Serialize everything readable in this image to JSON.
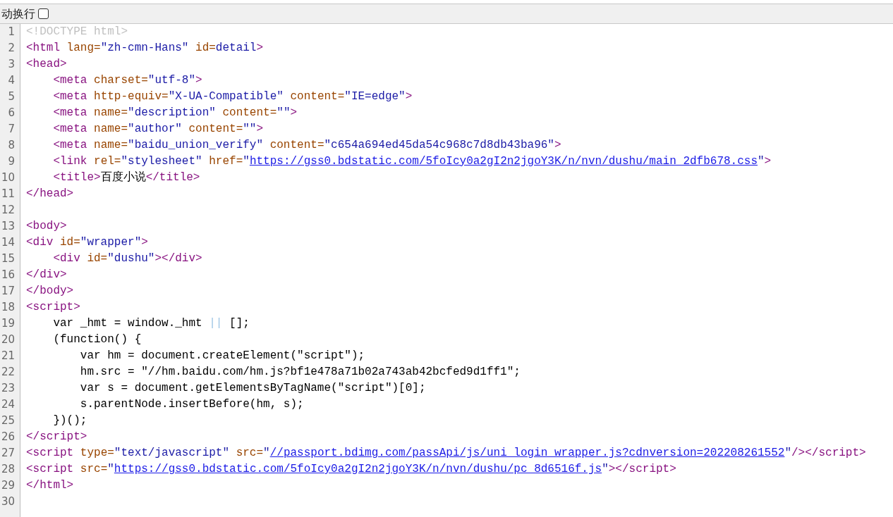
{
  "toolbar": {
    "label": "动换行",
    "checkbox": {
      "checked": false
    }
  },
  "lines": [
    {
      "number": "1",
      "tokens": [
        {
          "kind": "doctype",
          "text": "<!DOCTYPE html>"
        }
      ]
    },
    {
      "number": "2",
      "tokens": [
        {
          "kind": "tag",
          "text": "<html"
        },
        {
          "kind": "attr",
          "text": " lang="
        },
        {
          "kind": "value",
          "text": "\"zh-cmn-Hans\""
        },
        {
          "kind": "attr",
          "text": " id="
        },
        {
          "kind": "value",
          "text": "detail"
        },
        {
          "kind": "tag",
          "text": ">"
        }
      ]
    },
    {
      "number": "3",
      "tokens": [
        {
          "kind": "tag",
          "text": "<head>"
        }
      ]
    },
    {
      "number": "4",
      "tokens": [
        {
          "kind": "tag",
          "text": "    <meta"
        },
        {
          "kind": "attr",
          "text": " charset="
        },
        {
          "kind": "value",
          "text": "\"utf-8\""
        },
        {
          "kind": "tag",
          "text": ">"
        }
      ]
    },
    {
      "number": "5",
      "tokens": [
        {
          "kind": "tag",
          "text": "    <meta"
        },
        {
          "kind": "attr",
          "text": " http-equiv="
        },
        {
          "kind": "value",
          "text": "\"X-UA-Compatible\""
        },
        {
          "kind": "attr",
          "text": " content="
        },
        {
          "kind": "value",
          "text": "\"IE=edge\""
        },
        {
          "kind": "tag",
          "text": ">"
        }
      ]
    },
    {
      "number": "6",
      "tokens": [
        {
          "kind": "tag",
          "text": "    <meta"
        },
        {
          "kind": "attr",
          "text": " name="
        },
        {
          "kind": "value",
          "text": "\"description\""
        },
        {
          "kind": "attr",
          "text": " content="
        },
        {
          "kind": "value",
          "text": "\"\""
        },
        {
          "kind": "tag",
          "text": ">"
        }
      ]
    },
    {
      "number": "7",
      "tokens": [
        {
          "kind": "tag",
          "text": "    <meta"
        },
        {
          "kind": "attr",
          "text": " name="
        },
        {
          "kind": "value",
          "text": "\"author\""
        },
        {
          "kind": "attr",
          "text": " content="
        },
        {
          "kind": "value",
          "text": "\"\""
        },
        {
          "kind": "tag",
          "text": ">"
        }
      ]
    },
    {
      "number": "8",
      "tokens": [
        {
          "kind": "tag",
          "text": "    <meta"
        },
        {
          "kind": "attr",
          "text": " name="
        },
        {
          "kind": "value",
          "text": "\"baidu_union_verify\""
        },
        {
          "kind": "attr",
          "text": " content="
        },
        {
          "kind": "value",
          "text": "\"c654a694ed45da54c968c7d8db43ba96\""
        },
        {
          "kind": "tag",
          "text": ">"
        }
      ]
    },
    {
      "number": "9",
      "tokens": [
        {
          "kind": "tag",
          "text": "    <link"
        },
        {
          "kind": "attr",
          "text": " rel="
        },
        {
          "kind": "value",
          "text": "\"stylesheet\""
        },
        {
          "kind": "attr",
          "text": " href="
        },
        {
          "kind": "value",
          "text": "\""
        },
        {
          "kind": "link",
          "text": "https://gss0.bdstatic.com/5foIcy0a2gI2n2jgoY3K/n/nvn/dushu/main_2dfb678.css"
        },
        {
          "kind": "value",
          "text": "\""
        },
        {
          "kind": "tag",
          "text": ">"
        }
      ]
    },
    {
      "number": "10",
      "tokens": [
        {
          "kind": "tag",
          "text": "    <title>"
        },
        {
          "kind": "text",
          "text": "百度小说"
        },
        {
          "kind": "tag",
          "text": "</title>"
        }
      ]
    },
    {
      "number": "11",
      "tokens": [
        {
          "kind": "tag",
          "text": "</head>"
        }
      ]
    },
    {
      "number": "12"
    },
    {
      "number": "13",
      "tokens": [
        {
          "kind": "tag",
          "text": "<body>"
        }
      ]
    },
    {
      "number": "14",
      "tokens": [
        {
          "kind": "tag",
          "text": "<div"
        },
        {
          "kind": "attr",
          "text": " id="
        },
        {
          "kind": "value",
          "text": "\"wrapper\""
        },
        {
          "kind": "tag",
          "text": ">"
        }
      ]
    },
    {
      "number": "15",
      "tokens": [
        {
          "kind": "tag",
          "text": "    <div"
        },
        {
          "kind": "attr",
          "text": " id="
        },
        {
          "kind": "value",
          "text": "\"dushu\""
        },
        {
          "kind": "tag",
          "text": "></div>"
        }
      ]
    },
    {
      "number": "16",
      "tokens": [
        {
          "kind": "tag",
          "text": "</div>"
        }
      ]
    },
    {
      "number": "17",
      "tokens": [
        {
          "kind": "tag",
          "text": "</body>"
        }
      ]
    },
    {
      "number": "18",
      "tokens": [
        {
          "kind": "tag",
          "text": "<script>"
        }
      ]
    },
    {
      "number": "19",
      "tokens": [
        {
          "kind": "text",
          "text": "    var _hmt = window._hmt "
        },
        {
          "kind": "faint",
          "text": "||"
        },
        {
          "kind": "text",
          "text": " [];"
        }
      ]
    },
    {
      "number": "20",
      "tokens": [
        {
          "kind": "text",
          "text": "    (function() {"
        }
      ]
    },
    {
      "number": "21",
      "tokens": [
        {
          "kind": "text",
          "text": "        var hm = document.createElement(\"script\");"
        }
      ]
    },
    {
      "number": "22",
      "tokens": [
        {
          "kind": "text",
          "text": "        hm.src = \"//hm.baidu.com/hm.js?bf1e478a71b02a743ab42bcfed9d1ff1\";"
        }
      ]
    },
    {
      "number": "23",
      "tokens": [
        {
          "kind": "text",
          "text": "        var s = document.getElementsByTagName(\"script\")[0];"
        }
      ]
    },
    {
      "number": "24",
      "tokens": [
        {
          "kind": "text",
          "text": "        s.parentNode.insertBefore(hm, s);"
        }
      ]
    },
    {
      "number": "25",
      "tokens": [
        {
          "kind": "text",
          "text": "    })();"
        }
      ]
    },
    {
      "number": "26",
      "tokens": [
        {
          "kind": "tag",
          "text": "</script>"
        }
      ]
    },
    {
      "number": "27",
      "tokens": [
        {
          "kind": "tag",
          "text": "<script"
        },
        {
          "kind": "attr",
          "text": " type="
        },
        {
          "kind": "value",
          "text": "\"text/javascript\""
        },
        {
          "kind": "attr",
          "text": " src="
        },
        {
          "kind": "value",
          "text": "\""
        },
        {
          "kind": "link",
          "text": "//passport.bdimg.com/passApi/js/uni_login_wrapper.js?cdnversion=202208261552"
        },
        {
          "kind": "value",
          "text": "\""
        },
        {
          "kind": "tag",
          "text": "/></script>"
        }
      ]
    },
    {
      "number": "28",
      "tokens": [
        {
          "kind": "tag",
          "text": "<script"
        },
        {
          "kind": "attr",
          "text": " src="
        },
        {
          "kind": "value",
          "text": "\""
        },
        {
          "kind": "link",
          "text": "https://gss0.bdstatic.com/5foIcy0a2gI2n2jgoY3K/n/nvn/dushu/pc_8d6516f.js"
        },
        {
          "kind": "value",
          "text": "\""
        },
        {
          "kind": "tag",
          "text": "></script>"
        }
      ]
    },
    {
      "number": "29",
      "tokens": [
        {
          "kind": "tag",
          "text": "</html>"
        }
      ]
    },
    {
      "number": "30"
    }
  ]
}
